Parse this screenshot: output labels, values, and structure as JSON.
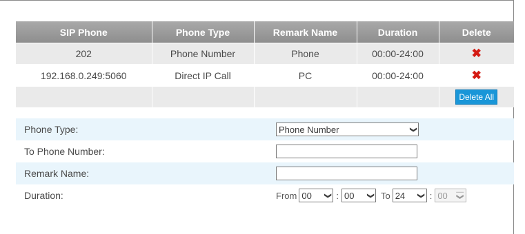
{
  "table": {
    "headers": [
      "SIP Phone",
      "Phone Type",
      "Remark Name",
      "Duration",
      "Delete"
    ],
    "rows": [
      {
        "sip": "202",
        "type": "Phone Number",
        "remark": "Phone",
        "duration": "00:00-24:00",
        "delete": "✖"
      },
      {
        "sip": "192.168.0.249:5060",
        "type": "Direct IP Call",
        "remark": "PC",
        "duration": "00:00-24:00",
        "delete": "✖"
      }
    ],
    "delete_all_label": "Delete All"
  },
  "form": {
    "phone_type_label": "Phone Type:",
    "phone_type_value": "Phone Number",
    "to_phone_label": "To Phone Number:",
    "to_phone_value": "",
    "remark_label": "Remark Name:",
    "remark_value": "",
    "duration_label": "Duration:",
    "from_label": "From",
    "from_hour": "00",
    "from_min": "00",
    "to_label": "To",
    "to_hour": "24",
    "to_min": "00",
    "colon": ":"
  },
  "colors": {
    "header_bg": "#9a9a9a",
    "row_gray": "#eaeaea",
    "form_tint": "#e9f5fc",
    "delete_red": "#d41b14",
    "button_blue": "#1996d8"
  },
  "icons": {
    "delete": "cross-icon",
    "dropdown": "chevron-down-icon"
  }
}
